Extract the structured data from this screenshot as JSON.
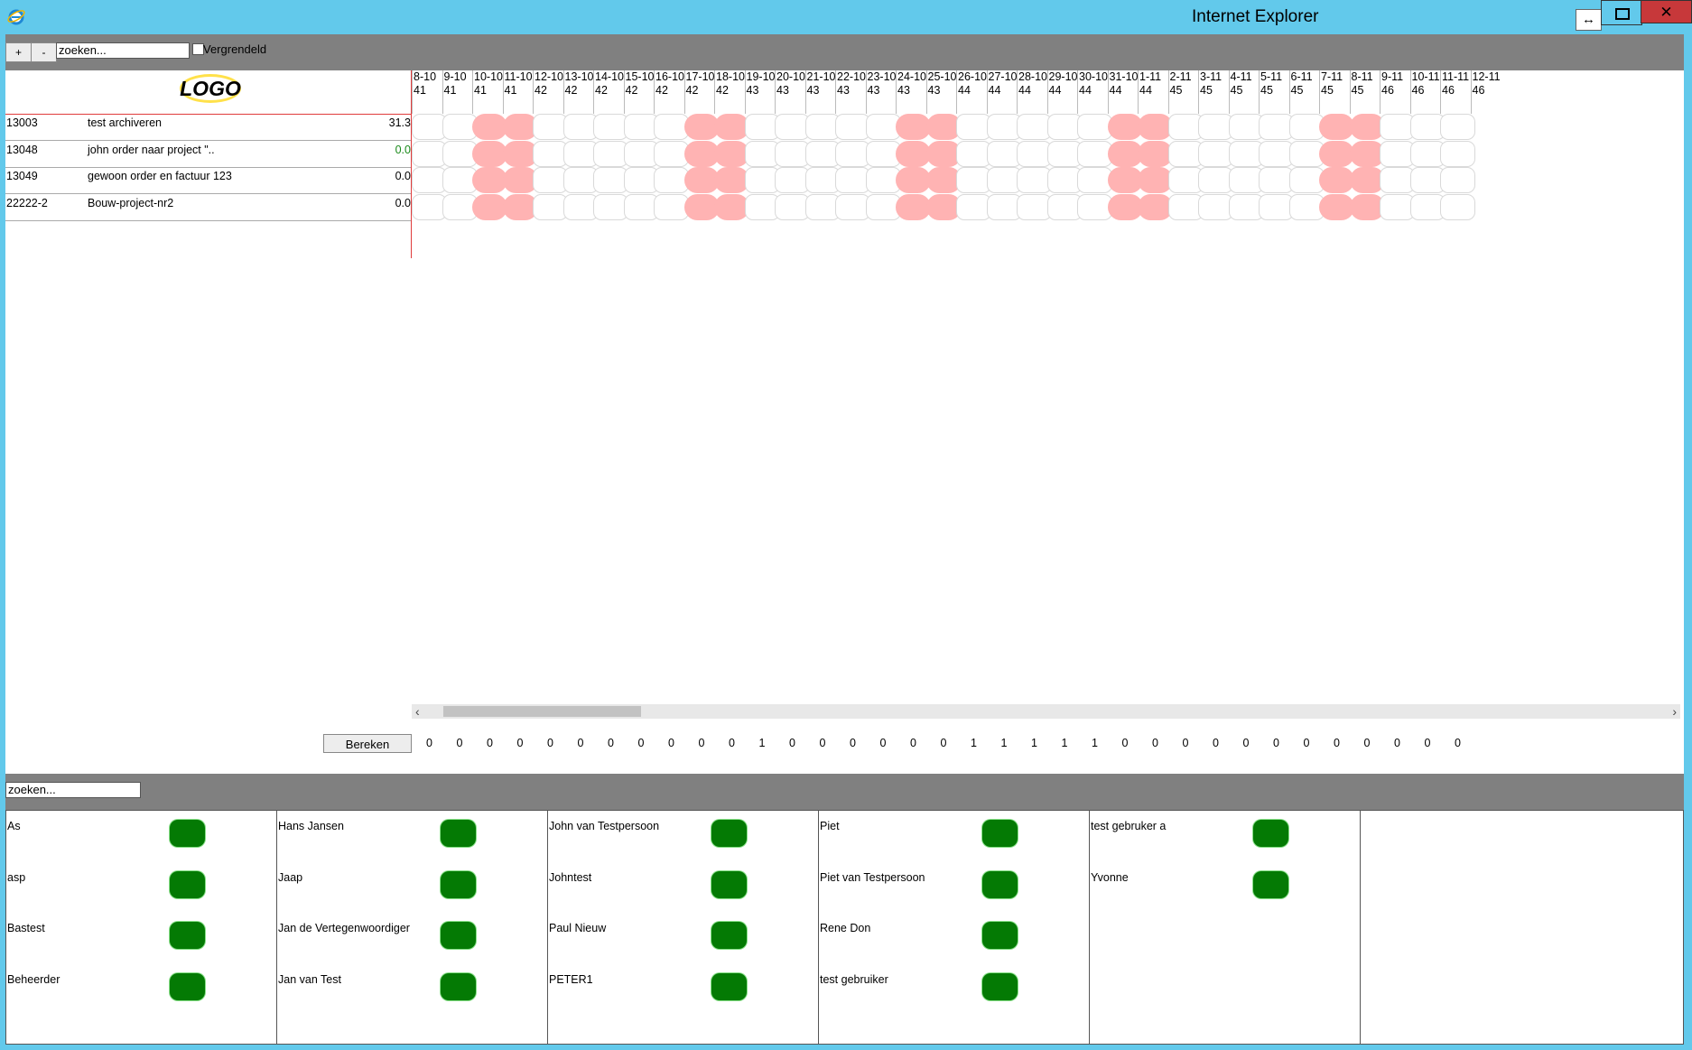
{
  "window": {
    "title": "Internet Explorer",
    "snap_glyph": "↔",
    "close_glyph": "✕"
  },
  "toolbar": {
    "plus_label": "+",
    "minus_label": "-",
    "search_value": "zoeken...",
    "locked_label": "Vergrendeld"
  },
  "logo": {
    "text": "LOGO"
  },
  "weeks": [
    {
      "date": "8-10",
      "week": "41"
    },
    {
      "date": "9-10",
      "week": "41"
    },
    {
      "date": "10-10",
      "week": "41"
    },
    {
      "date": "11-10",
      "week": "41"
    },
    {
      "date": "12-10",
      "week": "42"
    },
    {
      "date": "13-10",
      "week": "42"
    },
    {
      "date": "14-10",
      "week": "42"
    },
    {
      "date": "15-10",
      "week": "42"
    },
    {
      "date": "16-10",
      "week": "42"
    },
    {
      "date": "17-10",
      "week": "42"
    },
    {
      "date": "18-10",
      "week": "42"
    },
    {
      "date": "19-10",
      "week": "43"
    },
    {
      "date": "20-10",
      "week": "43"
    },
    {
      "date": "21-10",
      "week": "43"
    },
    {
      "date": "22-10",
      "week": "43"
    },
    {
      "date": "23-10",
      "week": "43"
    },
    {
      "date": "24-10",
      "week": "43"
    },
    {
      "date": "25-10",
      "week": "43"
    },
    {
      "date": "26-10",
      "week": "44"
    },
    {
      "date": "27-10",
      "week": "44"
    },
    {
      "date": "28-10",
      "week": "44"
    },
    {
      "date": "29-10",
      "week": "44"
    },
    {
      "date": "30-10",
      "week": "44"
    },
    {
      "date": "31-10",
      "week": "44"
    },
    {
      "date": "1-11",
      "week": "44"
    },
    {
      "date": "2-11",
      "week": "45"
    },
    {
      "date": "3-11",
      "week": "45"
    },
    {
      "date": "4-11",
      "week": "45"
    },
    {
      "date": "5-11",
      "week": "45"
    },
    {
      "date": "6-11",
      "week": "45"
    },
    {
      "date": "7-11",
      "week": "45"
    },
    {
      "date": "8-11",
      "week": "45"
    },
    {
      "date": "9-11",
      "week": "46"
    },
    {
      "date": "10-11",
      "week": "46"
    },
    {
      "date": "11-11",
      "week": "46"
    },
    {
      "date": "12-11",
      "week": "46"
    }
  ],
  "weekend_columns": [
    2,
    3,
    9,
    10,
    16,
    17,
    23,
    24,
    30,
    31
  ],
  "projects": [
    {
      "id": "13003",
      "name": "test archiveren",
      "value": "31.3",
      "value_color": "#000000"
    },
    {
      "id": "13048",
      "name": "john order naar project \"..",
      "value": "0.0",
      "value_color": "#1a8a1a"
    },
    {
      "id": "13049",
      "name": "gewoon order en factuur 123",
      "value": "0.0",
      "value_color": "#000000"
    },
    {
      "id": "22222-2",
      "name": "Bouw-project-nr2",
      "value": "0.0",
      "value_color": "#000000"
    }
  ],
  "scrollbar": {
    "left_glyph": "‹",
    "right_glyph": "›"
  },
  "bereken_label": "Bereken",
  "totals": [
    "0",
    "0",
    "0",
    "0",
    "0",
    "0",
    "0",
    "0",
    "0",
    "0",
    "0",
    "1",
    "0",
    "0",
    "0",
    "0",
    "0",
    "0",
    "1",
    "1",
    "1",
    "1",
    "1",
    "0",
    "0",
    "0",
    "0",
    "0",
    "0",
    "0",
    "0",
    "0",
    "0",
    "0",
    "0"
  ],
  "user_search": {
    "value": "zoeken..."
  },
  "user_columns": [
    [
      "As",
      "asp",
      "Bastest",
      "Beheerder"
    ],
    [
      "Hans Jansen",
      "Jaap",
      "Jan de Vertegenwoordiger",
      "Jan van Test"
    ],
    [
      "John van Testpersoon",
      "Johntest",
      "Paul Nieuw",
      "PETER1"
    ],
    [
      "Piet",
      "Piet van Testpersoon",
      "Rene Don",
      "test gebruiker"
    ],
    [
      "test gebruker a",
      "Yvonne"
    ],
    []
  ],
  "colors": {
    "weekend": "#ffb3b3",
    "user_status": "#047a04",
    "titlebar": "#62c9eb"
  }
}
